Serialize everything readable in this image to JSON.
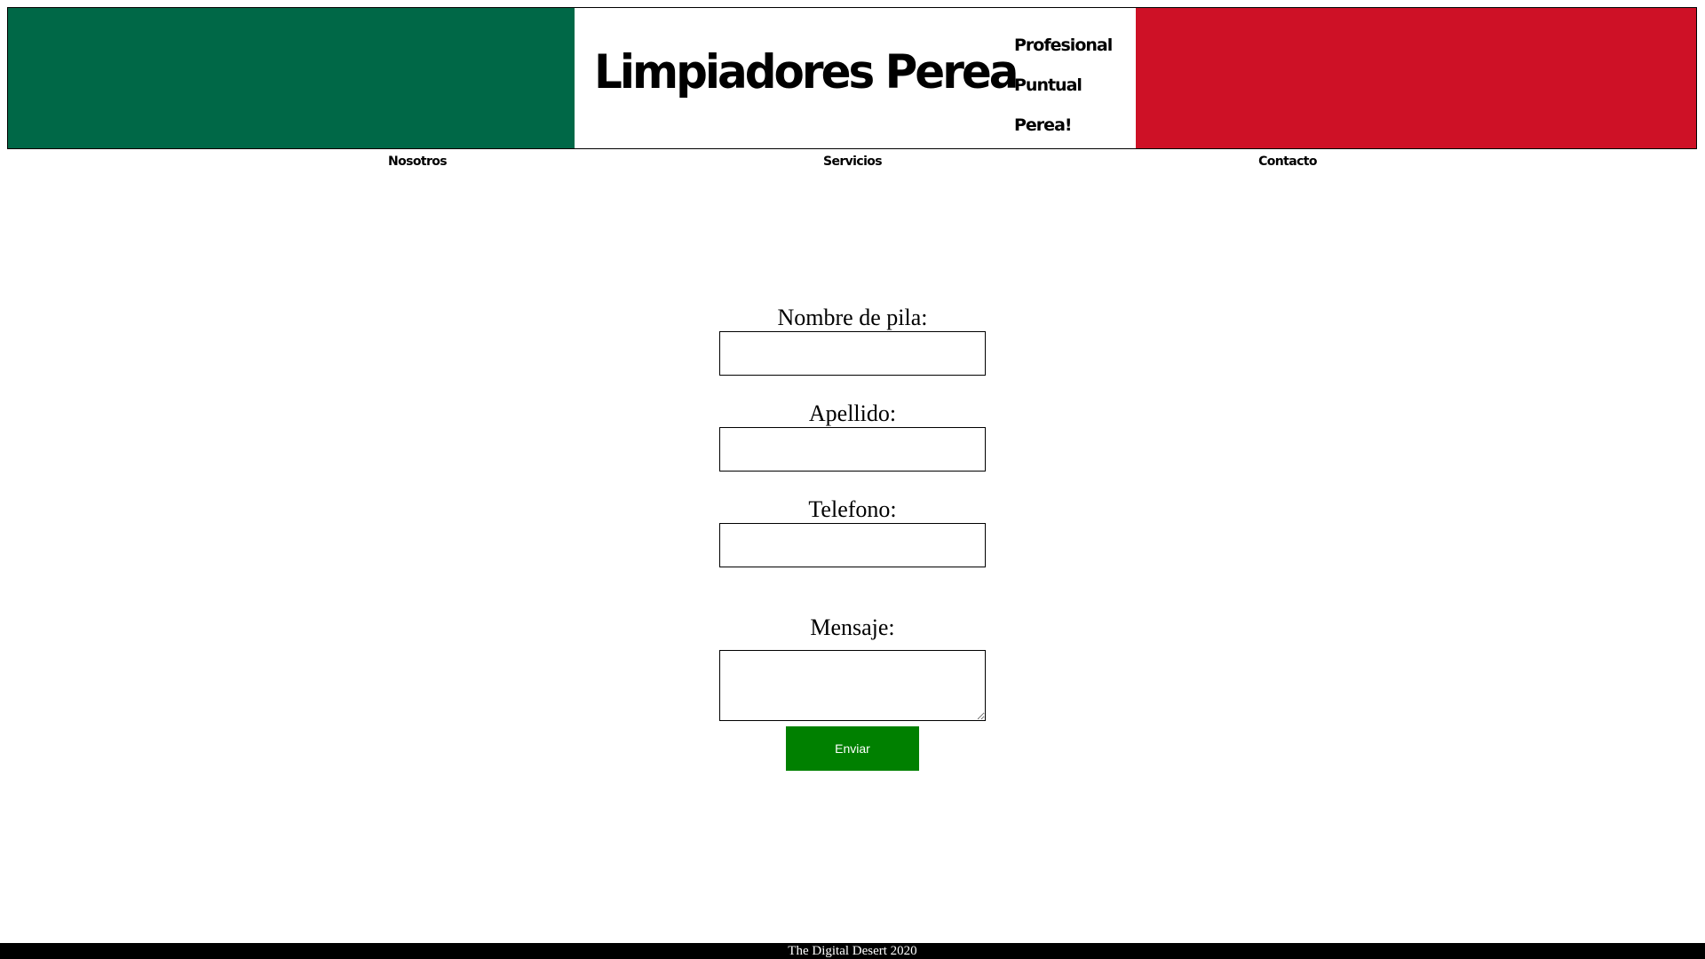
{
  "header": {
    "title": "Limpiadores Perea",
    "taglines": [
      "Profesional",
      "Puntual",
      "Perea!"
    ],
    "colors": {
      "green": "#006847",
      "white": "#ffffff",
      "red": "#ce1126"
    }
  },
  "nav": {
    "items": [
      {
        "label": "Nosotros"
      },
      {
        "label": "Servicios"
      },
      {
        "label": "Contacto"
      }
    ]
  },
  "form": {
    "fields": [
      {
        "label": "Nombre de pila:",
        "value": ""
      },
      {
        "label": "Apellido:",
        "value": ""
      },
      {
        "label": "Telefono:",
        "value": ""
      },
      {
        "label": "Mensaje:",
        "value": ""
      }
    ],
    "submit_label": "Enviar",
    "submit_color": "#008000"
  },
  "footer": {
    "text": "The Digital Desert 2020"
  }
}
